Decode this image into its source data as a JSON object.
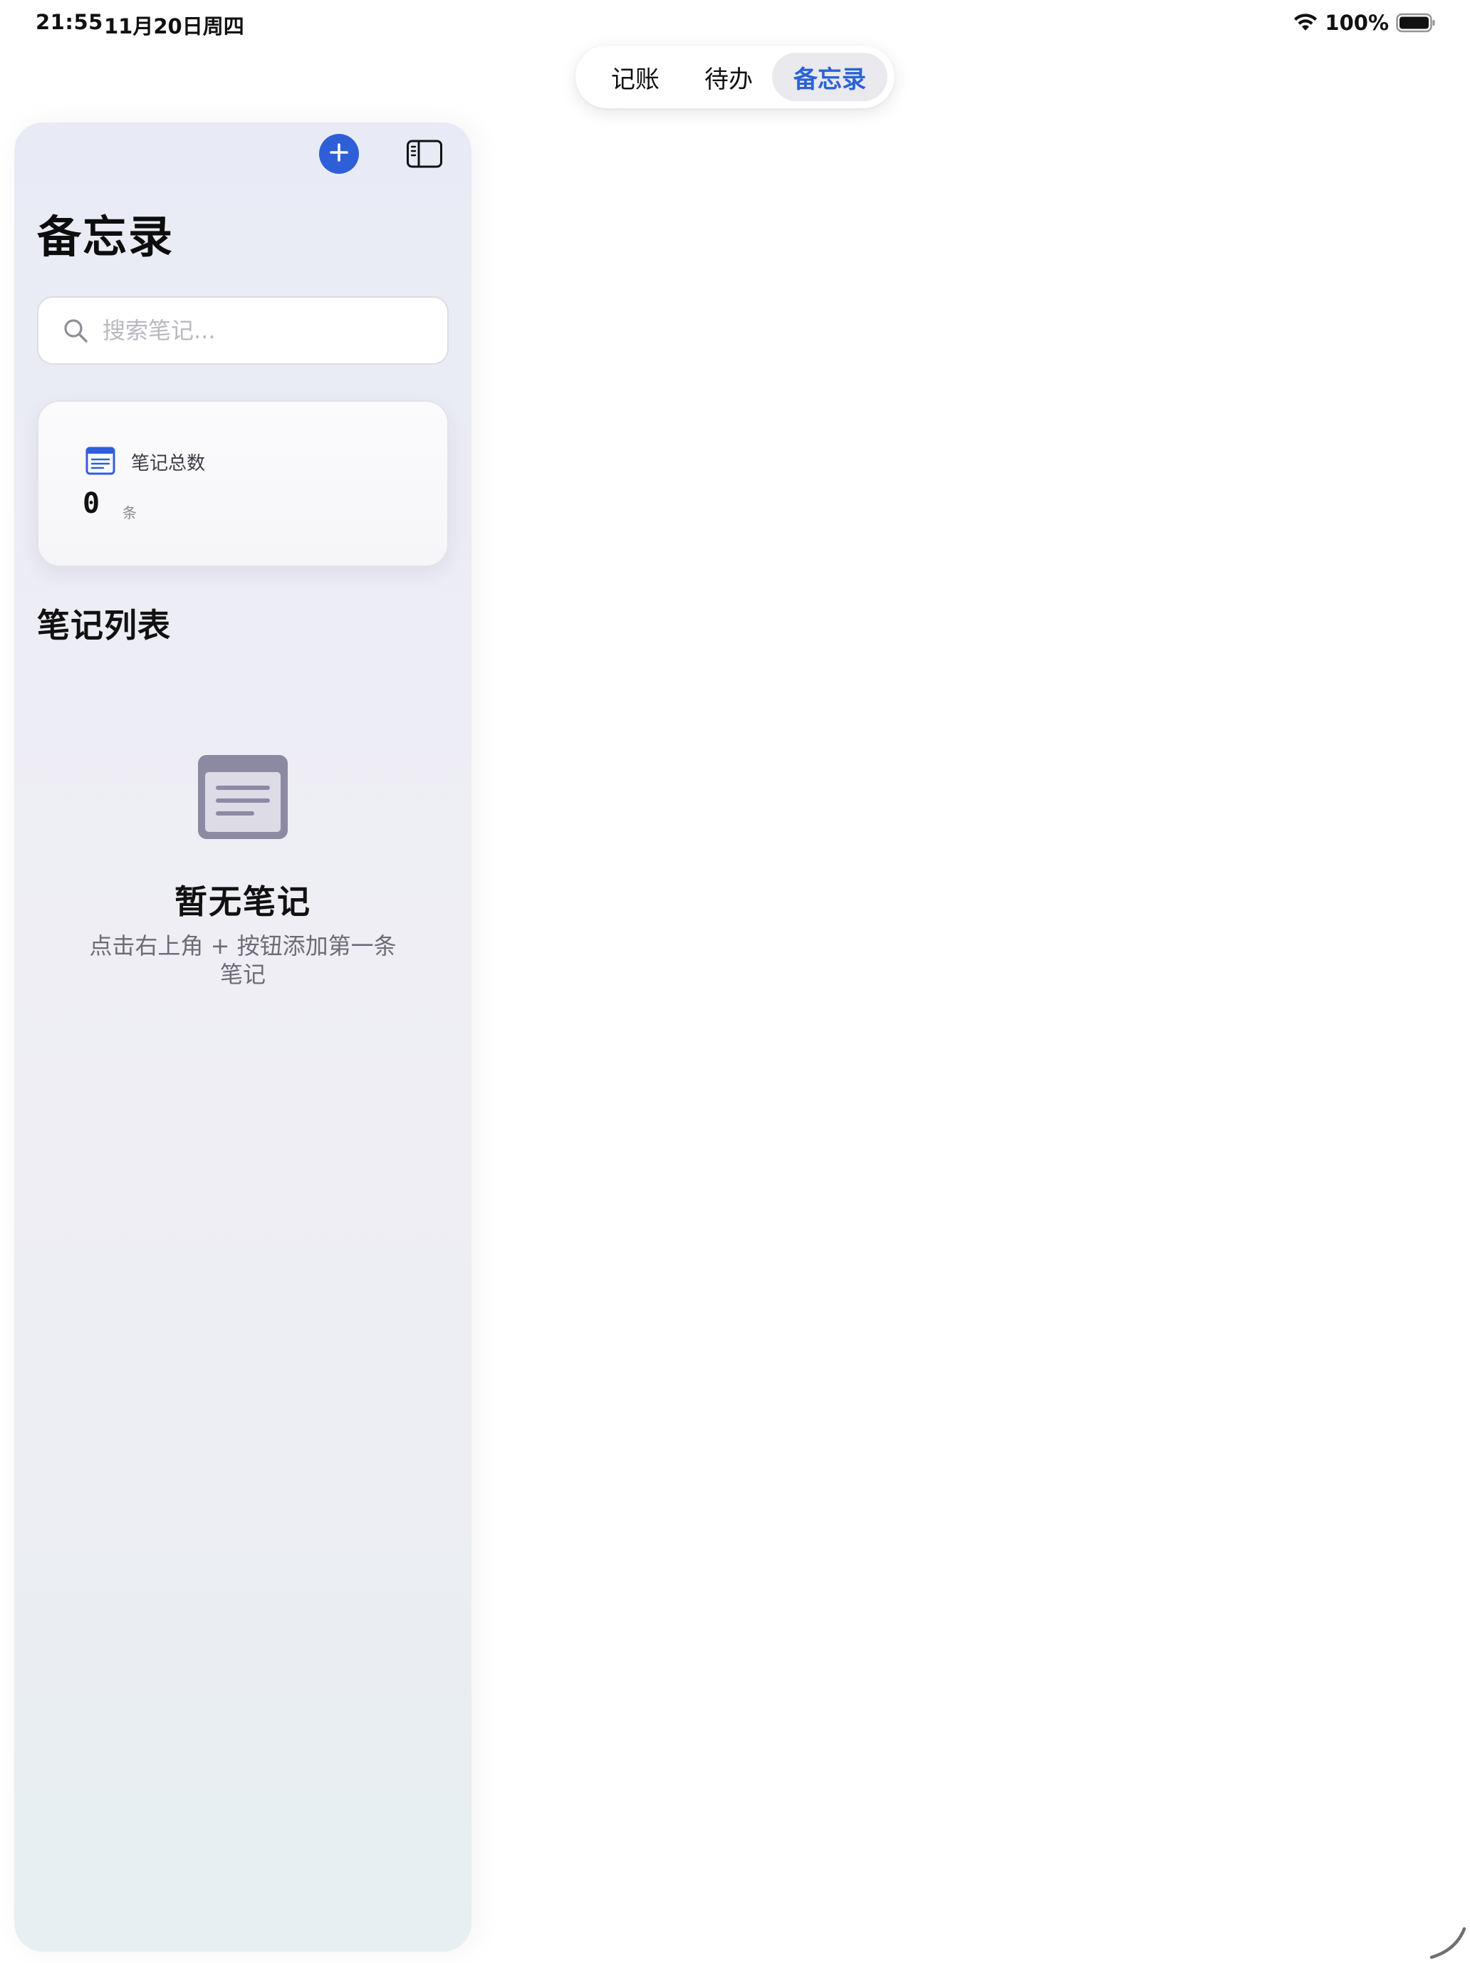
{
  "status_bar": {
    "time": "21:55",
    "date": "11月20日周四",
    "battery": "100%"
  },
  "tabs": [
    {
      "label": "记账"
    },
    {
      "label": "待办"
    },
    {
      "label": "备忘录",
      "selected": true
    }
  ],
  "sidebar": {
    "title": "备忘录",
    "search": {
      "placeholder": "搜索笔记...",
      "value": ""
    },
    "stats": {
      "label": "笔记总数",
      "value": "0",
      "unit": "条"
    },
    "list_title": "笔记列表",
    "empty_state": {
      "title": "暂无笔记",
      "description": "点击右上角 + 按钮添加第一条笔记"
    }
  },
  "icons": {
    "add": "plus-icon",
    "toggle": "sidebar-toggle-icon",
    "search": "search-icon",
    "stats": "document-icon",
    "empty": "notes-empty-icon",
    "wifi": "wifi-icon",
    "battery": "battery-icon"
  },
  "colors": {
    "accent": "#2e5fd9",
    "selected_tab_text": "#2a63d6",
    "selected_tab_bg": "#e9e9ee",
    "empty_icon": "#8c8aa3"
  }
}
